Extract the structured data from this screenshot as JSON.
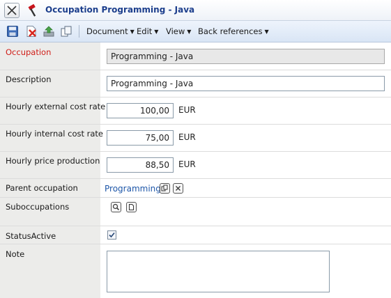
{
  "window": {
    "title": "Occupation Programming - Java",
    "close_icon": "close-icon",
    "app_icon": "hammer-icon"
  },
  "toolbar": {
    "icons": [
      "save-icon",
      "delete-icon",
      "export-icon",
      "copy-icon"
    ],
    "menus": [
      {
        "label": "Document"
      },
      {
        "label": "Edit"
      },
      {
        "label": "View"
      },
      {
        "label": "Back references"
      }
    ]
  },
  "form": {
    "occupation": {
      "label": "Occupation",
      "value": "Programming - Java",
      "required": true
    },
    "description": {
      "label": "Description",
      "value": "Programming - Java"
    },
    "hourly_external": {
      "label": "Hourly external cost rate",
      "value": "100,00",
      "unit": "EUR"
    },
    "hourly_internal": {
      "label": "Hourly internal cost rate",
      "value": "75,00",
      "unit": "EUR"
    },
    "hourly_price": {
      "label": "Hourly price production",
      "value": "88,50",
      "unit": "EUR"
    },
    "parent": {
      "label": "Parent occupation",
      "value": "Programming"
    },
    "suboccupations": {
      "label": "Suboccupations"
    },
    "status": {
      "label": "StatusActive",
      "checked": true
    },
    "note": {
      "label": "Note",
      "value": ""
    }
  },
  "colors": {
    "required_label": "#d0201a",
    "title": "#1c3e8c",
    "link": "#1d56a8"
  }
}
